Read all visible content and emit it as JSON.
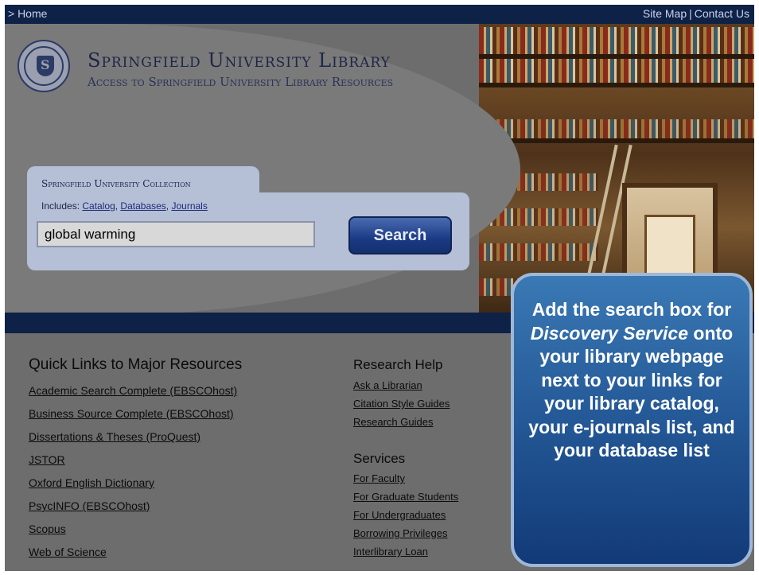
{
  "topbar": {
    "home_label": "> Home",
    "sitemap_label": "Site Map",
    "separator": "|",
    "contact_label": "Contact Us",
    "color": "#0e2147"
  },
  "header": {
    "title": "Springfield University Library",
    "subtitle": "Access to Springfield University Library Resources",
    "logo_text": "UNIVERSITY LIBRARY SPRINGFIELD"
  },
  "search": {
    "collection_title": "Springfield University Collection",
    "includes_label": "Includes:",
    "includes_links": [
      "Catalog",
      "Databases",
      "Journals"
    ],
    "input_value": "global warming",
    "button_label": "Search"
  },
  "quick_links": {
    "heading": "Quick Links to Major Resources",
    "items": [
      "Academic Search Complete (EBSCOhost)",
      "Business Source Complete (EBSCOhost)",
      "Dissertations & Theses (ProQuest)",
      "JSTOR",
      "Oxford English Dictionary",
      "PsycINFO (EBSCOhost)",
      "Scopus",
      "Web of Science"
    ]
  },
  "research_help": {
    "heading": "Research Help",
    "items": [
      "Ask a Librarian",
      "Citation Style Guides",
      "Research Guides"
    ]
  },
  "services": {
    "heading": "Services",
    "items": [
      "For Faculty",
      "For Graduate Students",
      "For Undergraduates",
      "Borrowing Privileges",
      "Interlibrary Loan"
    ]
  },
  "callout": {
    "line1": "Add the search box for",
    "emphasis": "Discovery Service",
    "line2": "onto your library webpage next to your links for your library catalog, your e-journals list, and your database list"
  }
}
